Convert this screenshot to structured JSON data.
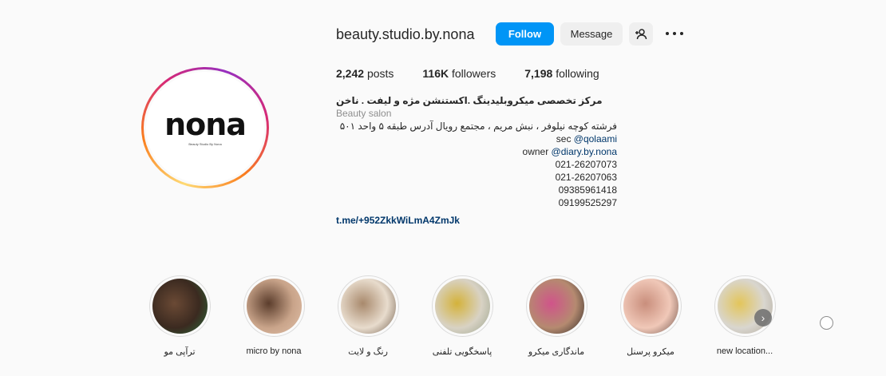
{
  "profile": {
    "username": "beauty.studio.by.nona",
    "avatar_text": "nona",
    "avatar_subtext": "Beauty Studio By Nona",
    "buttons": {
      "follow": "Follow",
      "message": "Message",
      "add_user_icon": "add-user-icon",
      "more_icon": "more-icon"
    },
    "stats": {
      "posts_count": "2,242",
      "posts_label": "posts",
      "followers_count": "116K",
      "followers_label": "followers",
      "following_count": "7,198",
      "following_label": "following"
    },
    "bio": {
      "title": "مرکز تخصصی میکروبلیدینگ .اکستنشن مژه و لیفت . ناخن",
      "category": "Beauty salon",
      "address": "فرشته کوچه نیلوفر ، نبش مریم ، مجتمع رویال آدرس طبقه ۵ واحد ۵۰۱",
      "sec_prefix": "sec ",
      "sec_handle": "@qolaami",
      "owner_prefix": "owner ",
      "owner_handle": "@diary.by.nona",
      "phones": [
        "021-26207073",
        "021-26207063",
        "09385961418",
        "09199525297"
      ],
      "link": "t.me/+952ZkkWiLmA4ZmJk"
    }
  },
  "highlights": [
    {
      "label": "ترآپی مو",
      "colors": [
        "#3b2a20",
        "#6b4a35",
        "#2a6b3a"
      ]
    },
    {
      "label": "micro by nona",
      "colors": [
        "#c9a48a",
        "#5b3d2c",
        "#e1c0a8"
      ]
    },
    {
      "label": "رنگ و لایت",
      "colors": [
        "#e8dccd",
        "#a8896c",
        "#6e5a48"
      ]
    },
    {
      "label": "پاسخگویی تلفنی",
      "colors": [
        "#d8d2c4",
        "#d4b23a",
        "#9aa38c"
      ]
    },
    {
      "label": "ماندگاری میکرو",
      "colors": [
        "#b58a70",
        "#d0548a",
        "#2a2624"
      ]
    },
    {
      "label": "میکرو پرسنل",
      "colors": [
        "#f0c8b8",
        "#c98e7c",
        "#6a4d44"
      ]
    },
    {
      "label": "new location...",
      "colors": [
        "#d9d6cf",
        "#e3c55a",
        "#b0a89a"
      ]
    }
  ],
  "controls": {
    "next_icon": "chevron-right-icon",
    "radio_icon": "radio-icon"
  }
}
